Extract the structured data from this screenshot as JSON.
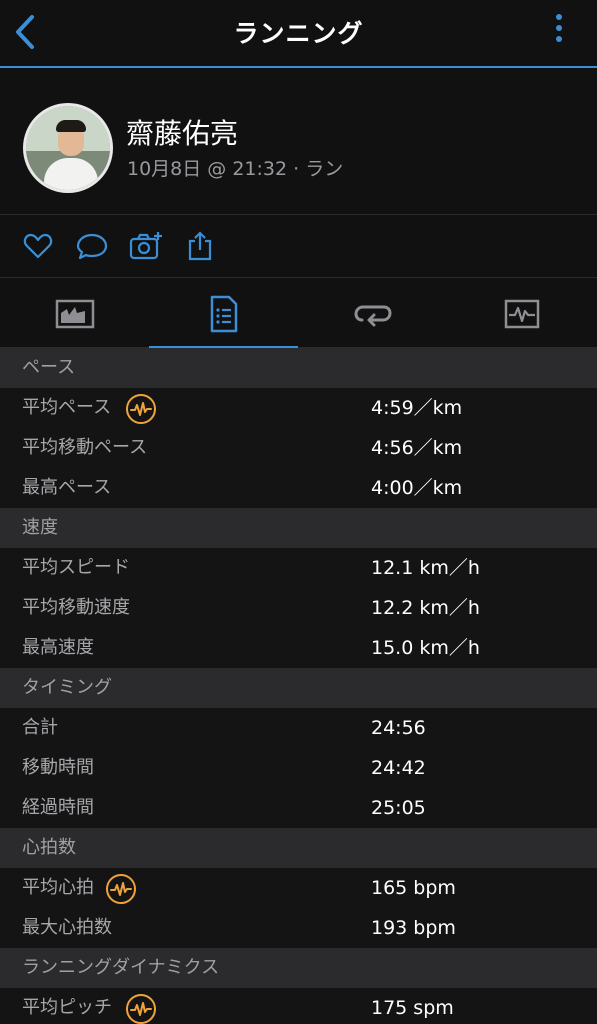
{
  "header": {
    "title": "ランニング"
  },
  "profile": {
    "name": "齋藤佑亮",
    "meta": "10月8日 @ 21:32 · ラン"
  },
  "colors": {
    "accent": "#3a8fd6",
    "badge": "#f0a33b",
    "background": "#111111",
    "section": "#2b2b2d"
  },
  "actions": [
    "heart-icon",
    "comment-icon",
    "camera-add-icon",
    "share-icon"
  ],
  "tabs": [
    "chart-icon",
    "document-list-icon",
    "laps-icon",
    "graph-icon"
  ],
  "sections": [
    {
      "title": "ペース",
      "rows": [
        {
          "label": "平均ペース",
          "value": "4:59／km",
          "badge": true
        },
        {
          "label": "平均移動ペース",
          "value": "4:56／km"
        },
        {
          "label": "最高ペース",
          "value": "4:00／km"
        }
      ]
    },
    {
      "title": "速度",
      "rows": [
        {
          "label": "平均スピード",
          "value": "12.1 km／h"
        },
        {
          "label": "平均移動速度",
          "value": "12.2 km／h"
        },
        {
          "label": "最高速度",
          "value": "15.0 km／h"
        }
      ]
    },
    {
      "title": "タイミング",
      "rows": [
        {
          "label": "合計",
          "value": "24:56"
        },
        {
          "label": "移動時間",
          "value": "24:42"
        },
        {
          "label": "経過時間",
          "value": "25:05"
        }
      ]
    },
    {
      "title": "心拍数",
      "rows": [
        {
          "label": "平均心拍",
          "value": "165 bpm",
          "badge": true
        },
        {
          "label": "最大心拍数",
          "value": "193 bpm"
        }
      ]
    },
    {
      "title": "ランニングダイナミクス",
      "rows": [
        {
          "label": "平均ピッチ",
          "value": "175 spm",
          "badge": true
        }
      ]
    }
  ]
}
